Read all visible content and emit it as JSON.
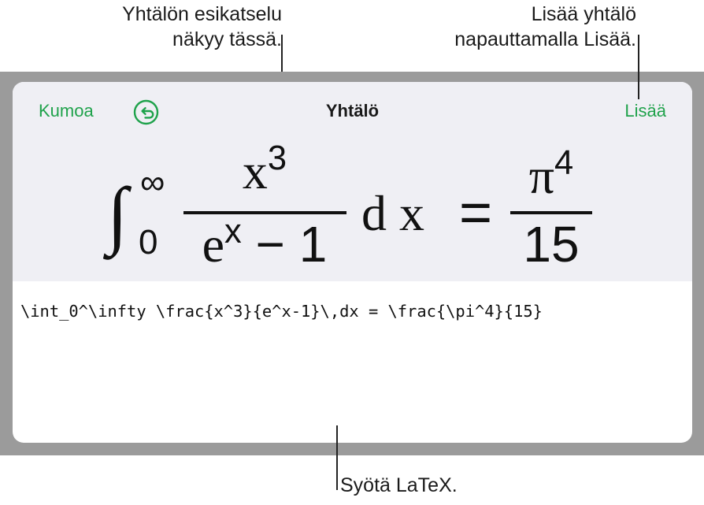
{
  "callouts": {
    "preview": [
      "Yhtälön esikatselu",
      "näkyy tässä."
    ],
    "insert": [
      "Lisää yhtälö",
      "napauttamalla Lisää."
    ],
    "latex": "Syötä LaTeX."
  },
  "sheet": {
    "undo_label": "Kumoa",
    "undo_icon": "undo-arrow-icon",
    "title": "Yhtälö",
    "insert_label": "Lisää"
  },
  "equation": {
    "integral_sign": "∫",
    "upper_limit": "∞",
    "lower_limit": "0",
    "numerator_base": "x",
    "numerator_exp": "3",
    "denominator_base": "e",
    "denominator_exp": "x",
    "denominator_rest": " − 1",
    "differential": "d x",
    "equals": "=",
    "rhs_num_base": "π",
    "rhs_num_exp": "4",
    "rhs_den": "15"
  },
  "latex_source": "\\int_0^\\infty \\frac{x^3}{e^x-1}\\,dx = \\frac{\\pi^4}{15}",
  "colors": {
    "accent": "#1fa24b",
    "backdrop": "#9b9b9b",
    "header_bg": "#efeff4"
  }
}
